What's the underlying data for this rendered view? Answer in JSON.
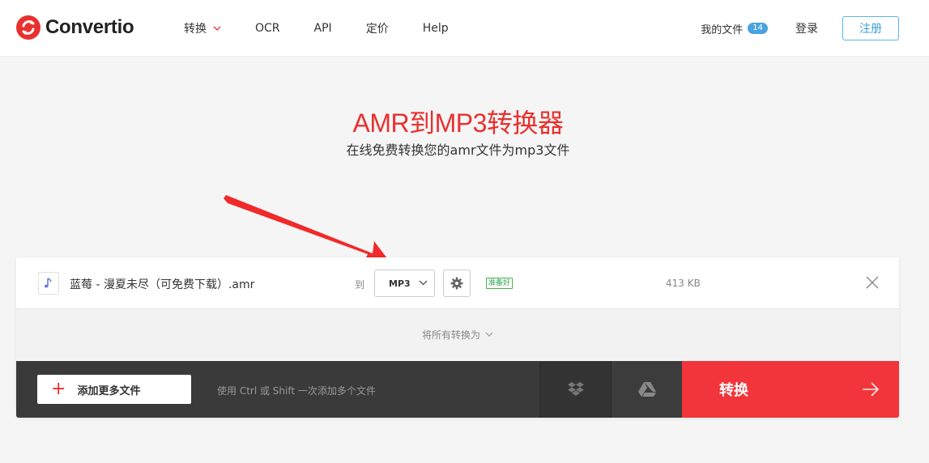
{
  "header": {
    "logo_text": "Convertio",
    "nav": [
      {
        "label": "转换",
        "has_dropdown": true
      },
      {
        "label": "OCR"
      },
      {
        "label": "API"
      },
      {
        "label": "定价"
      },
      {
        "label": "Help"
      }
    ],
    "my_files_label": "我的文件",
    "my_files_count": "14",
    "login_label": "登录",
    "register_label": "注册"
  },
  "hero": {
    "title": "AMR到MP3转换器",
    "subtitle": "在线免费转换您的amr文件为mp3文件"
  },
  "file": {
    "name": "蓝莓 - 漫夏未尽（可免费下载）.amr",
    "to_label": "到",
    "format": "MP3",
    "status": "准备好",
    "size": "413 KB"
  },
  "convert_all_label": "将所有转换为",
  "actions": {
    "add_files_label": "添加更多文件",
    "hint": "使用 Ctrl 或 Shift 一次添加多个文件",
    "convert_label": "转换"
  },
  "colors": {
    "brand_red": "#e8312f",
    "convert_red": "#f1353a",
    "badge_blue": "#4aa3df",
    "ready_green": "#2fa84f",
    "action_bar": "#3a3a3a"
  },
  "icons": [
    "convertio-logo-icon",
    "chevron-down-icon",
    "music-note-icon",
    "gear-icon",
    "close-icon",
    "plus-icon",
    "dropbox-icon",
    "google-drive-icon",
    "arrow-right-icon"
  ]
}
